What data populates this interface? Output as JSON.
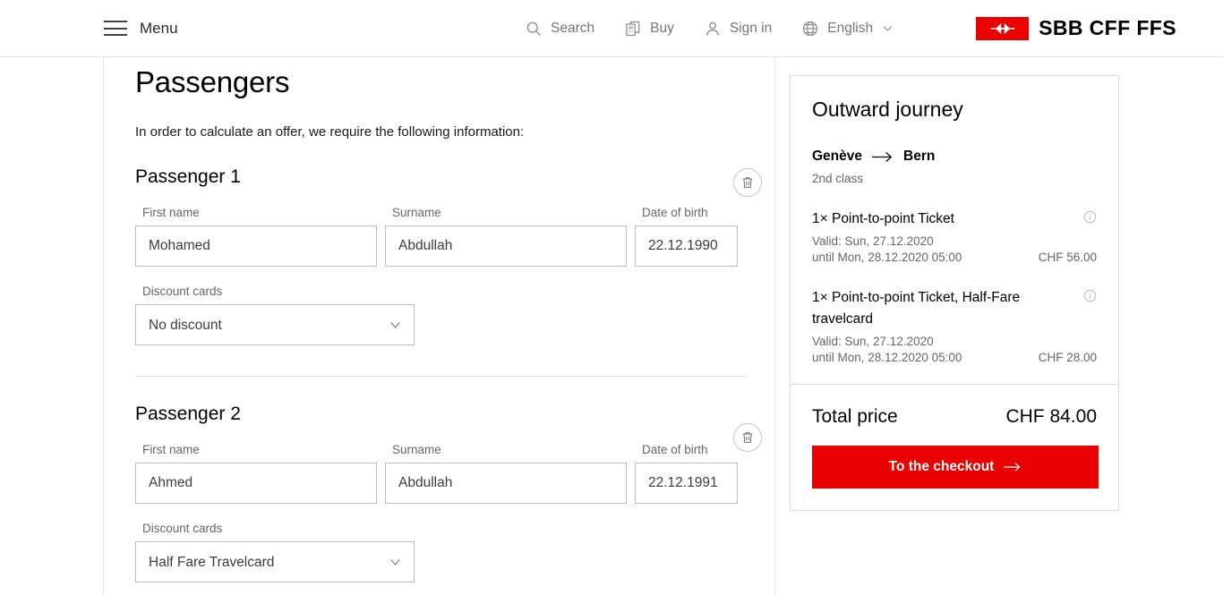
{
  "header": {
    "menu_label": "Menu",
    "nav": [
      {
        "label": "Search",
        "icon": "search-icon"
      },
      {
        "label": "Buy",
        "icon": "ticket-icon"
      },
      {
        "label": "Sign in",
        "icon": "user-icon"
      },
      {
        "label": "English",
        "icon": "globe-icon"
      }
    ],
    "logo_text": "SBB CFF FFS",
    "logo_color": "#EB0000"
  },
  "main": {
    "title": "Passengers",
    "intro": "In order to calculate an offer, we require the following information:",
    "labels": {
      "first_name": "First name",
      "surname": "Surname",
      "date_of_birth": "Date of birth",
      "discount_cards": "Discount cards"
    },
    "passengers": [
      {
        "title": "Passenger 1",
        "first_name": "Mohamed",
        "surname": "Abdullah",
        "date_of_birth": "22.12.1990",
        "discount": "No discount"
      },
      {
        "title": "Passenger 2",
        "first_name": "Ahmed",
        "surname": "Abdullah",
        "date_of_birth": "22.12.1991",
        "discount": "Half Fare Travelcard"
      }
    ],
    "discount_options": [
      "No discount",
      "Half Fare Travelcard"
    ]
  },
  "aside": {
    "card_title": "Outward journey",
    "origin": "Genève",
    "destination": "Bern",
    "travel_class": "2nd class",
    "tickets": [
      {
        "name": "1× Point-to-point Ticket",
        "valid": "Valid: Sun, 27.12.2020",
        "until": "until Mon, 28.12.2020 05:00",
        "price": "CHF 56.00"
      },
      {
        "name": "1× Point-to-point Ticket, Half-Fare travelcard",
        "valid": "Valid: Sun, 27.12.2020",
        "until": "until Mon, 28.12.2020 05:00",
        "price": "CHF 28.00"
      }
    ],
    "total_label": "Total price",
    "total_value": "CHF 84.00",
    "checkout_label": "To the checkout"
  }
}
